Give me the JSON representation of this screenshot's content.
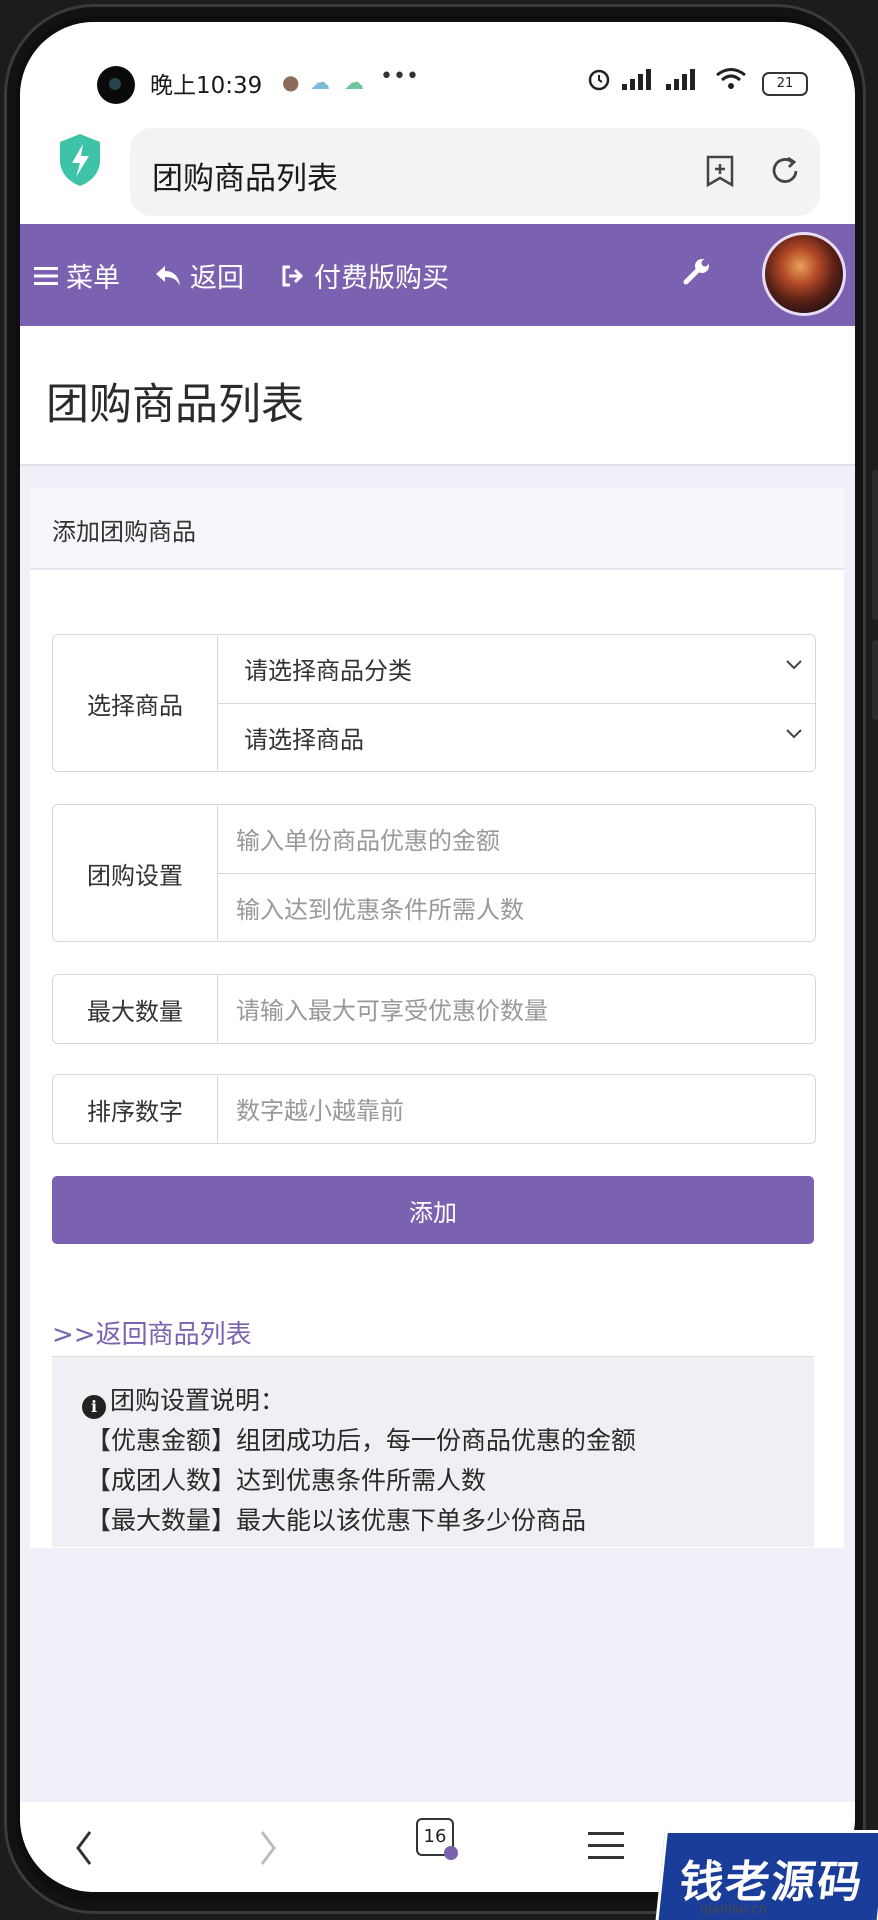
{
  "status": {
    "time": "晚上10:39",
    "battery": "21"
  },
  "browser": {
    "page_title": "团购商品列表",
    "tab_count": "16"
  },
  "nav": {
    "menu": "菜单",
    "back": "返回",
    "buy": "付费版购买"
  },
  "page": {
    "title": "团购商品列表"
  },
  "card": {
    "heading": "添加团购商品",
    "select_goods": {
      "label": "选择商品",
      "category_value": "请选择商品分类",
      "goods_value": "请选择商品"
    },
    "group_settings": {
      "label": "团购设置",
      "discount_placeholder": "输入单份商品优惠的金额",
      "people_placeholder": "输入达到优惠条件所需人数"
    },
    "max_qty": {
      "label": "最大数量",
      "placeholder": "请输入最大可享受优惠价数量"
    },
    "sort": {
      "label": "排序数字",
      "placeholder": "数字越小越靠前"
    },
    "submit_label": "添加",
    "back_link": ">>返回商品列表",
    "help": {
      "title": "团购设置说明：",
      "lines": [
        "【优惠金额】组团成功后，每一份商品优惠的金额",
        "【成团人数】达到优惠条件所需人数",
        "【最大数量】最大能以该优惠下单多少份商品"
      ]
    }
  },
  "watermark": {
    "text": "钱老源码",
    "url": "qianlao.cn"
  },
  "colors": {
    "accent": "#7b62b0",
    "shield": "#3ec2a8"
  }
}
